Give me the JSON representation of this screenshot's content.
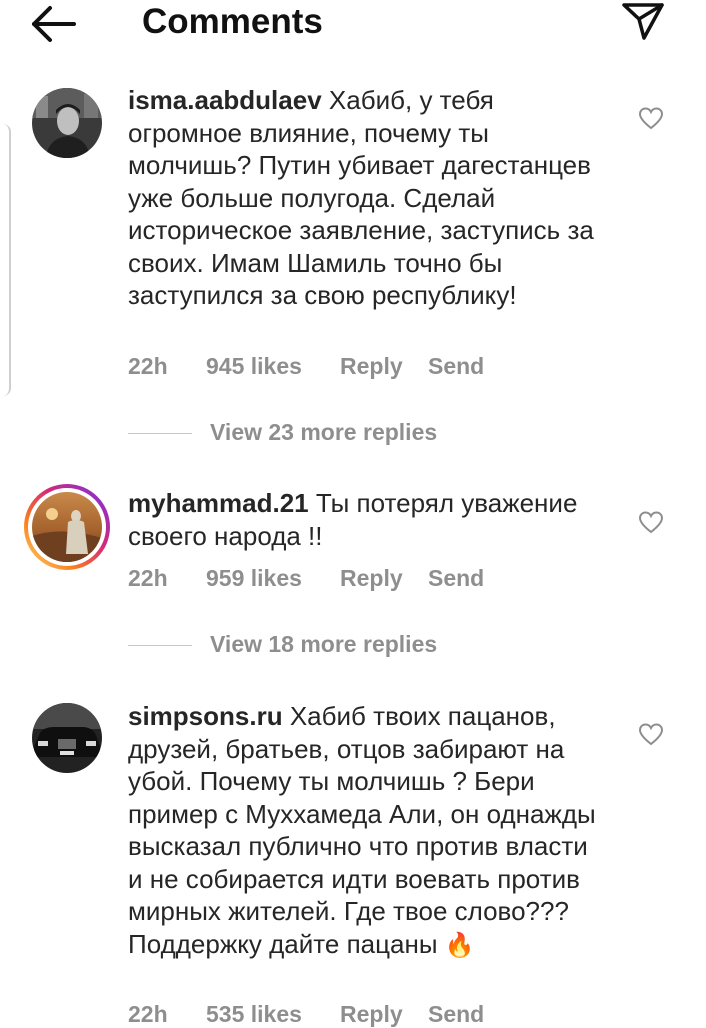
{
  "header": {
    "title": "Comments",
    "back_icon": "arrow-left-icon",
    "send_icon": "paper-plane-icon"
  },
  "comments": [
    {
      "username": "isma.aabdulaev",
      "text": "Хабиб, у тебя огромное влияние, почему ты молчишь? Путин убивает дагестанцев уже больше полугода. Сделай историческое заявление, заступись за своих. Имам Шамиль точно бы заступился за свою республику!",
      "time": "22h",
      "likes": "945 likes",
      "reply": "Reply",
      "send": "Send",
      "view_more": "View 23 more replies"
    },
    {
      "username": "myhammad.21",
      "text": "Ты потерял уважение своего народа !!",
      "time": "22h",
      "likes": "959 likes",
      "reply": "Reply",
      "send": "Send",
      "view_more": "View 18 more replies"
    },
    {
      "username": "simpsons.ru",
      "text": "Хабиб твоих пацанов, друзей, братьев, отцов забирают на убой. Почему ты молчишь ? Бери пример с Муххамеда Али, он однажды высказал публично что против власти и не собирается идти воевать против мирных жителей. Где твое слово??? Поддержку дайте пацаны",
      "emoji": "🔥",
      "time": "22h",
      "likes": "535 likes",
      "reply": "Reply",
      "send": "Send"
    }
  ],
  "colors": {
    "text": "#262626",
    "meta": "#8e8e8e",
    "story_ring_start": "#feda75",
    "story_ring_end": "#962fbf"
  }
}
